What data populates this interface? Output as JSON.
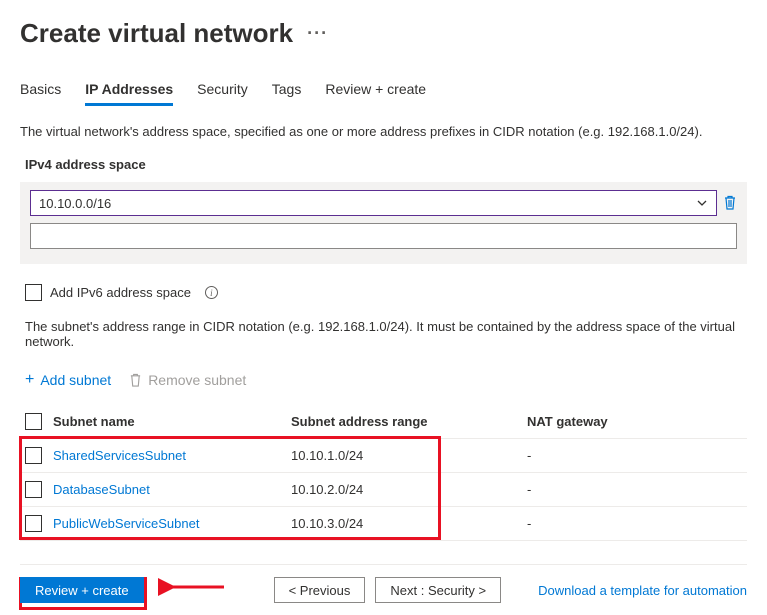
{
  "header": {
    "title": "Create virtual network"
  },
  "tabs": [
    {
      "id": "basics",
      "label": "Basics",
      "active": false
    },
    {
      "id": "ip",
      "label": "IP Addresses",
      "active": true
    },
    {
      "id": "security",
      "label": "Security",
      "active": false
    },
    {
      "id": "tags",
      "label": "Tags",
      "active": false
    },
    {
      "id": "review",
      "label": "Review + create",
      "active": false
    }
  ],
  "description": "The virtual network's address space, specified as one or more address prefixes in CIDR notation (e.g. 192.168.1.0/24).",
  "ipv4": {
    "label": "IPv4 address space",
    "entries": [
      "10.10.0.0/16"
    ]
  },
  "ipv6": {
    "checkbox_label": "Add IPv6 address space"
  },
  "subnet_description": "The subnet's address range in CIDR notation (e.g. 192.168.1.0/24). It must be contained by the address space of the virtual network.",
  "subnet_actions": {
    "add": "Add subnet",
    "remove": "Remove subnet"
  },
  "subnet_table": {
    "headers": {
      "name": "Subnet name",
      "range": "Subnet address range",
      "nat": "NAT gateway"
    },
    "rows": [
      {
        "name": "SharedServicesSubnet",
        "range": "10.10.1.0/24",
        "nat": "-"
      },
      {
        "name": "DatabaseSubnet",
        "range": "10.10.2.0/24",
        "nat": "-"
      },
      {
        "name": "PublicWebServiceSubnet",
        "range": "10.10.3.0/24",
        "nat": "-"
      }
    ]
  },
  "footer": {
    "review": "Review + create",
    "previous": "< Previous",
    "next": "Next : Security >",
    "download": "Download a template for automation"
  }
}
